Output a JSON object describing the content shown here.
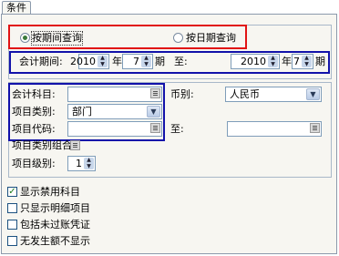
{
  "tabs": [
    {
      "label": "条件"
    }
  ],
  "query_mode": {
    "by_period": {
      "label": "按期间查询",
      "selected": true
    },
    "by_date": {
      "label": "按日期查询",
      "selected": false
    }
  },
  "period": {
    "label": "会计期间:",
    "from_year": "2010",
    "year_unit": "年",
    "from_period": "7",
    "period_unit": "期",
    "to_label": "至:",
    "to_year": "2010",
    "to_period": "7"
  },
  "filters": {
    "account_label": "会计科目:",
    "account_value": "",
    "currency_label": "币别:",
    "currency_value": "人民币",
    "item_category_label": "项目类别:",
    "item_category_value": "部门",
    "item_code_label": "项目代码:",
    "item_code_value": "",
    "to_label": "至:",
    "item_code_to_value": "",
    "item_group_label": "项目类别组合:",
    "item_level_label": "项目级别:",
    "item_level_value": "1"
  },
  "options": [
    {
      "label": "显示禁用科目",
      "checked": true
    },
    {
      "label": "只显示明细项目",
      "checked": false
    },
    {
      "label": "包括未过账凭证",
      "checked": false
    },
    {
      "label": "无发生额不显示",
      "checked": false
    }
  ]
}
